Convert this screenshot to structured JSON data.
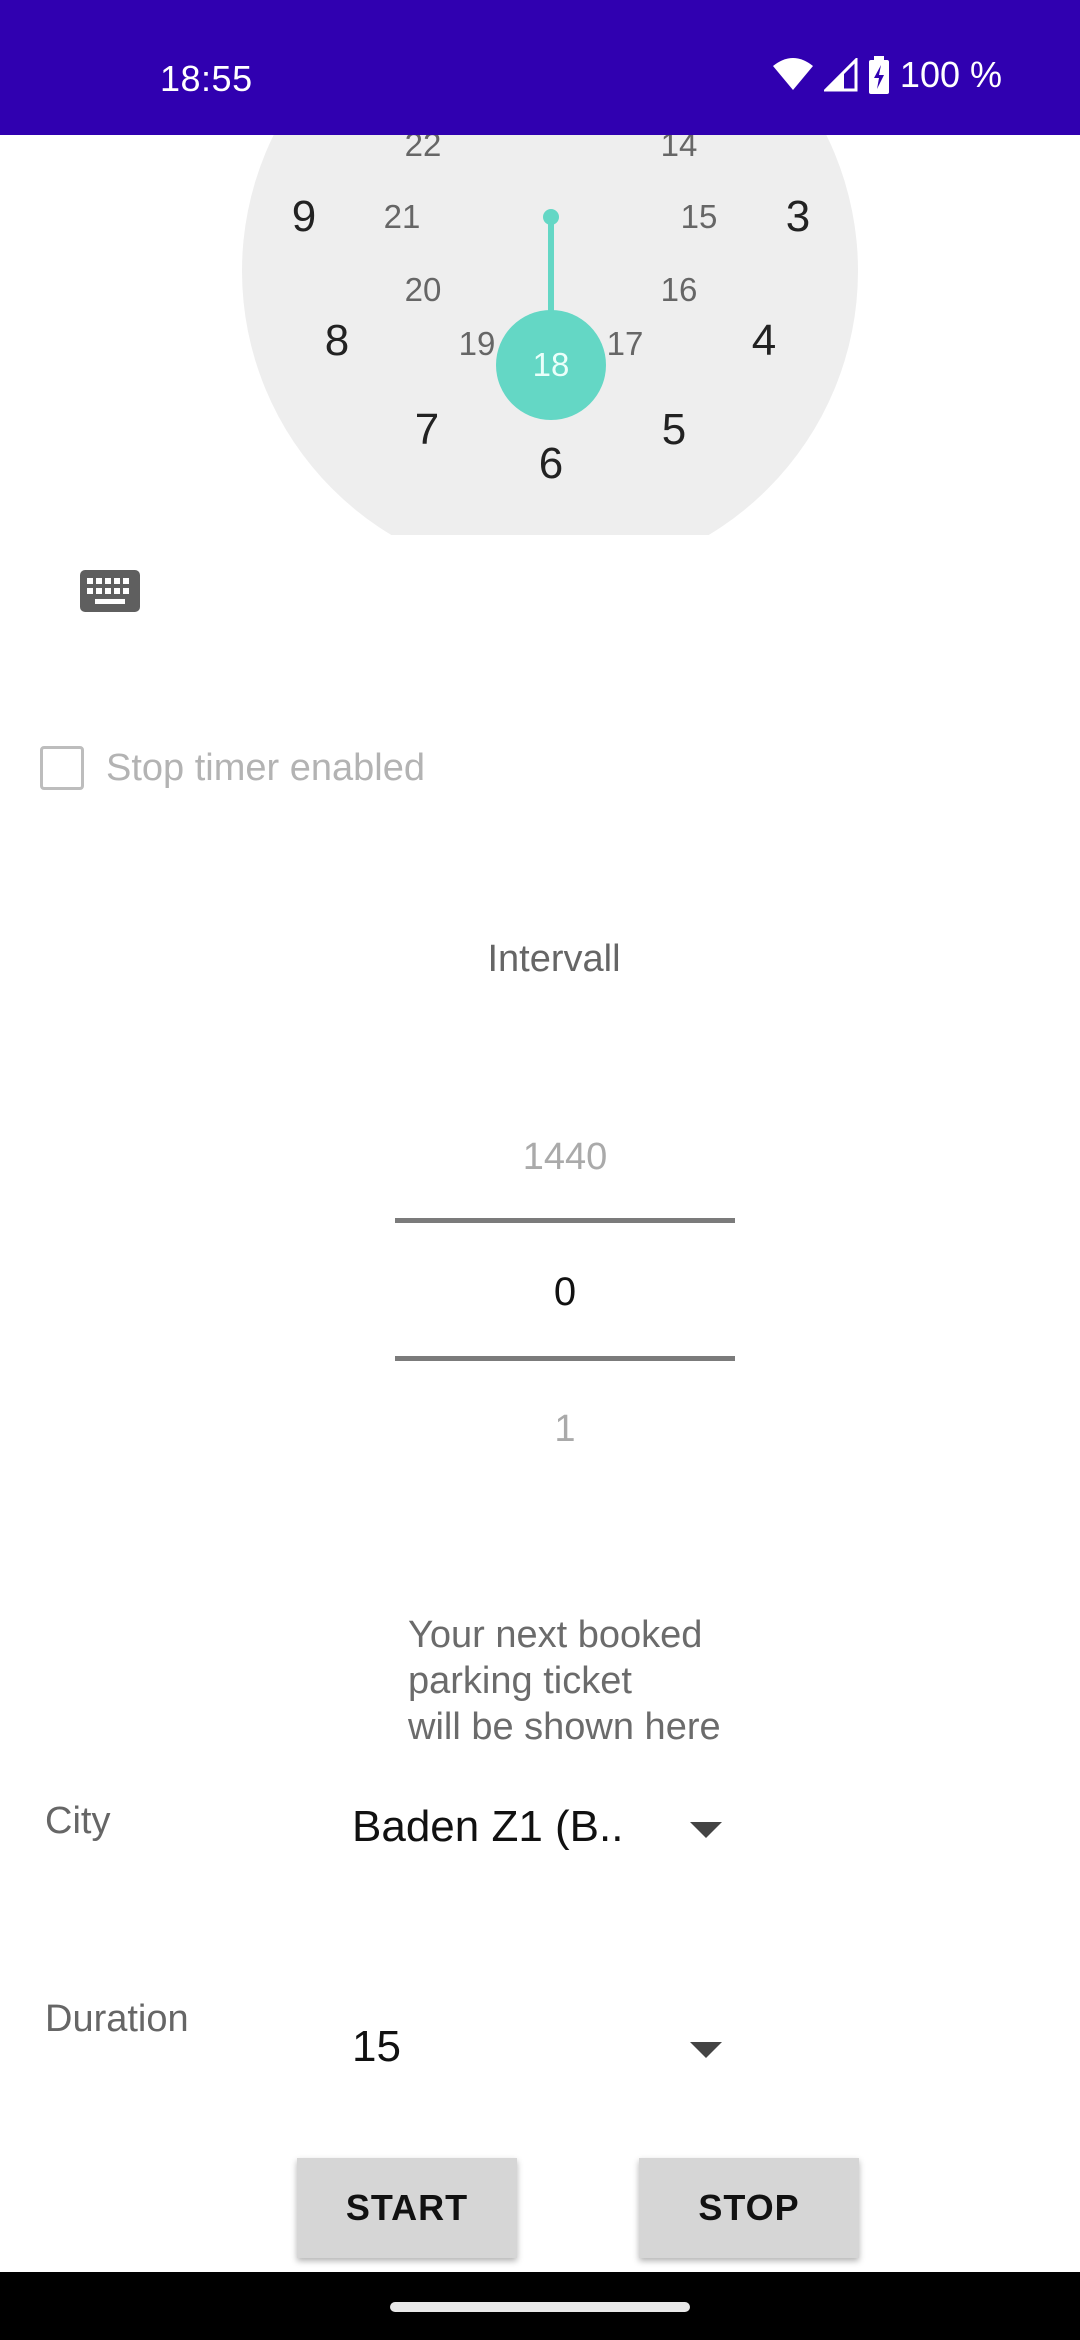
{
  "status_bar": {
    "time": "18:55",
    "battery": "100 %",
    "icons": [
      "wifi-icon",
      "cell-signal-icon",
      "battery-charging-icon"
    ]
  },
  "clock": {
    "accent_color": "#64d7c5",
    "selected_hour": "18",
    "numbers_outer": [
      "9",
      "3",
      "8",
      "4",
      "7",
      "5",
      "6"
    ],
    "numbers_inner": [
      "22",
      "14",
      "21",
      "15",
      "20",
      "16",
      "19",
      "17"
    ]
  },
  "keyboard_icon": "keyboard-icon",
  "stop_timer": {
    "label": "Stop timer enabled",
    "checked": false
  },
  "intervall": {
    "label": "Intervall",
    "picker": {
      "prev": "1440",
      "current": "0",
      "next": "1"
    }
  },
  "ticket_info": {
    "line1": "Your next booked",
    "line2": "parking ticket",
    "line3": "will be shown here"
  },
  "city": {
    "label": "City",
    "value": "Baden Z1 (B.."
  },
  "duration": {
    "label": "Duration",
    "value": "15"
  },
  "buttons": {
    "start": "START",
    "stop": "STOP"
  }
}
